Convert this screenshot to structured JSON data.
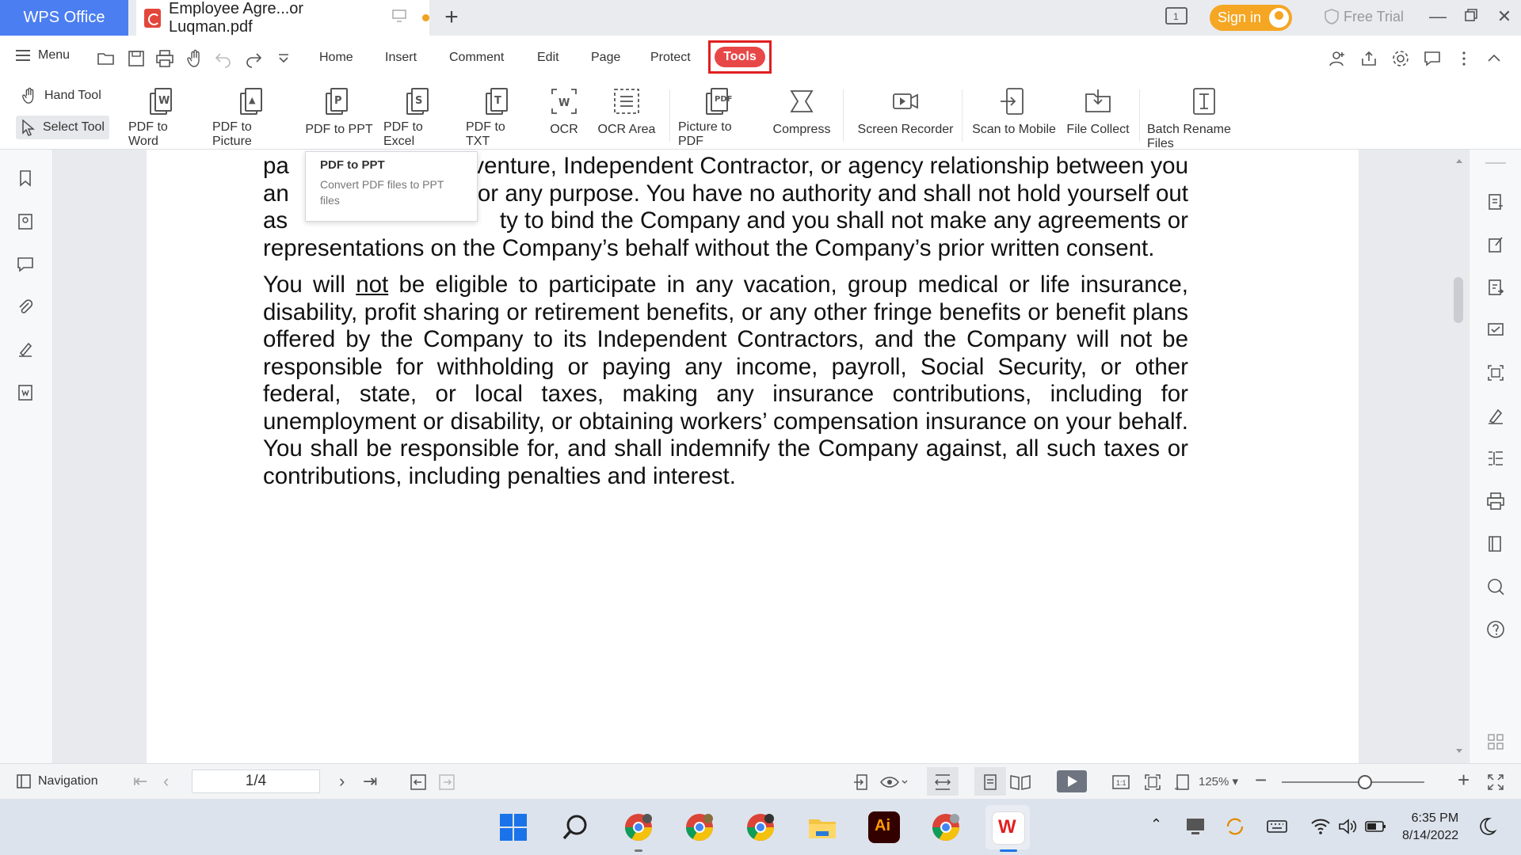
{
  "tabbar": {
    "app_name": "WPS Office",
    "document_tab": "Employee Agre...or Luqman.pdf",
    "sign_in": "Sign in",
    "free_trial": "Free Trial"
  },
  "menu": {
    "menu_label": "Menu",
    "tabs": [
      "Home",
      "Insert",
      "Comment",
      "Edit",
      "Page",
      "Protect"
    ],
    "active_tab": "Tools"
  },
  "ribbon": {
    "hand_tool": "Hand Tool",
    "select_tool": "Select Tool",
    "tools": [
      "PDF to Word",
      "PDF to Picture",
      "PDF to PPT",
      "PDF to Excel",
      "PDF to TXT",
      "OCR",
      "OCR Area",
      "Picture to PDF",
      "Compress",
      "Screen Recorder",
      "Scan to Mobile",
      "File Collect",
      "Batch Rename Files"
    ],
    "highlighted_tool": "PDF to PPT"
  },
  "tooltip": {
    "title": "PDF to PPT",
    "description": "Convert PDF files to PPT files"
  },
  "document": {
    "para1_line1_a": "pa",
    "para1_line1_b": "venture, Independent Contractor, or agency relationship between you",
    "para1_line2_a": "an",
    "para1_line2_b": "for any purpose. You have no authority and shall not hold yourself out",
    "para1_line3_a": "as",
    "para1_line3_b": "ty to bind the Company and you shall not make any agreements or",
    "para1_line4": "representations on the Company’s behalf without the Company’s prior written consent.",
    "para2_pre": "You will ",
    "para2_underlined": "not",
    "para2_post": " be eligible to participate in any vacation, group medical or life insurance, disability, profit sharing or retirement benefits, or any other fringe benefits or benefit plans offered by the Company to its Independent Contractors, and the Company will not be responsible for withholding or paying any income, payroll, Social Security, or other federal, state, or local taxes, making any insurance contributions, including for unemployment or disability, or obtaining workers’ compensation insurance on your behalf. You shall be responsible for, and shall indemnify the Company against, all such taxes or contributions, including penalties and interest."
  },
  "statusbar": {
    "navigation": "Navigation",
    "page_indicator": "1/4",
    "zoom": "125%"
  },
  "taskbar": {
    "time": "6:35 PM",
    "date": "8/14/2022"
  },
  "colors": {
    "accent": "#4b7ef0",
    "highlight_red": "#e02020",
    "tools_pill": "#e84747",
    "sign_in": "#f5a623"
  }
}
